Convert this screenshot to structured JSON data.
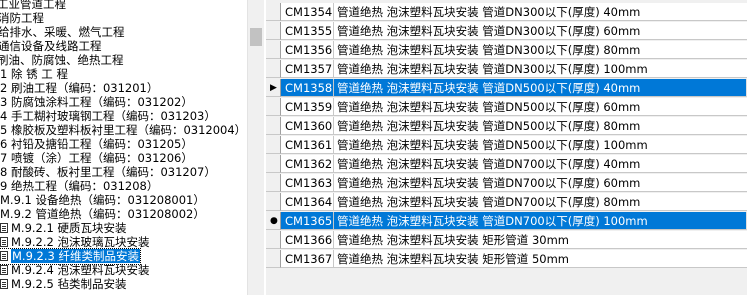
{
  "tree": [
    {
      "label": "工业管道工程",
      "doc": false
    },
    {
      "label": "消防工程",
      "doc": false
    },
    {
      "label": "给排水、采暖、燃气工程",
      "doc": false
    },
    {
      "label": "通信设备及线路工程",
      "doc": false
    },
    {
      "label": "刷油、防腐蚀、绝热工程",
      "doc": false
    },
    {
      "label": "1 除 锈 工 程",
      "doc": false
    },
    {
      "label": "2 刷油工程（编码：031201）",
      "doc": false
    },
    {
      "label": "3 防腐蚀涂料工程（编码：031202）",
      "doc": false
    },
    {
      "label": "4 手工糊衬玻璃钢工程（编码：031203）",
      "doc": false
    },
    {
      "label": "5 橡胶板及塑料板衬里工程（编码：0312004）",
      "doc": false
    },
    {
      "label": "6 衬铅及搪铅工程（编码：031205）",
      "doc": false
    },
    {
      "label": "7 喷镀（涂）工程（编码：031206）",
      "doc": false
    },
    {
      "label": "8 耐酸砖、板衬里工程（编码：031207）",
      "doc": false
    },
    {
      "label": "9 绝热工程（编码：031208）",
      "doc": false
    },
    {
      "label": "M.9.1 设备绝热（编码：031208001）",
      "doc": false
    },
    {
      "label": "M.9.2 管道绝热（编码：031208002）",
      "doc": false
    },
    {
      "label": "M.9.2.1 硬质瓦块安装",
      "doc": true
    },
    {
      "label": "M.9.2.2 泡沫玻璃瓦块安装",
      "doc": true
    },
    {
      "label": "M.9.2.3 纤维类制品安装",
      "doc": true,
      "selected": true
    },
    {
      "label": "M.9.2.4 泡沫塑料瓦块安装",
      "doc": true
    },
    {
      "label": "M.9.2.5 毡类制品安装",
      "doc": true
    }
  ],
  "grid": {
    "rows": [
      {
        "code": "CM1354",
        "name": "管道绝热 泡沫塑料瓦块安装 管道DN300以下(厚度) 40mm",
        "marker": ""
      },
      {
        "code": "CM1355",
        "name": "管道绝热 泡沫塑料瓦块安装 管道DN300以下(厚度) 60mm",
        "marker": ""
      },
      {
        "code": "CM1356",
        "name": "管道绝热 泡沫塑料瓦块安装 管道DN300以下(厚度) 80mm",
        "marker": ""
      },
      {
        "code": "CM1357",
        "name": "管道绝热 泡沫塑料瓦块安装 管道DN300以下(厚度) 100mm",
        "marker": ""
      },
      {
        "code": "CM1358",
        "name": "管道绝热 泡沫塑料瓦块安装 管道DN500以下(厚度) 40mm",
        "marker": "▶",
        "highlight": true
      },
      {
        "code": "CM1359",
        "name": "管道绝热 泡沫塑料瓦块安装 管道DN500以下(厚度) 60mm",
        "marker": ""
      },
      {
        "code": "CM1360",
        "name": "管道绝热 泡沫塑料瓦块安装 管道DN500以下(厚度) 80mm",
        "marker": ""
      },
      {
        "code": "CM1361",
        "name": "管道绝热 泡沫塑料瓦块安装 管道DN500以下(厚度) 100mm",
        "marker": ""
      },
      {
        "code": "CM1362",
        "name": "管道绝热 泡沫塑料瓦块安装 管道DN700以下(厚度) 40mm",
        "marker": ""
      },
      {
        "code": "CM1363",
        "name": "管道绝热 泡沫塑料瓦块安装 管道DN700以下(厚度) 60mm",
        "marker": ""
      },
      {
        "code": "CM1364",
        "name": "管道绝热 泡沫塑料瓦块安装 管道DN700以下(厚度) 80mm",
        "marker": ""
      },
      {
        "code": "CM1365",
        "name": "管道绝热 泡沫塑料瓦块安装 管道DN700以下(厚度) 100mm",
        "marker": "●",
        "highlight": true
      },
      {
        "code": "CM1366",
        "name": "管道绝热 泡沫塑料瓦块安装 矩形管道 30mm",
        "marker": ""
      },
      {
        "code": "CM1367",
        "name": "管道绝热 泡沫塑料瓦块安装 矩形管道 50mm",
        "marker": ""
      }
    ]
  },
  "colors": {
    "selection": "#0078d7",
    "grid_line": "#c8c8c8",
    "panel": "#f0f0f0"
  },
  "icons": {
    "tree_leaf": "document-icon",
    "current_row": "row-pointer-icon",
    "edit_row": "row-dot-icon"
  }
}
